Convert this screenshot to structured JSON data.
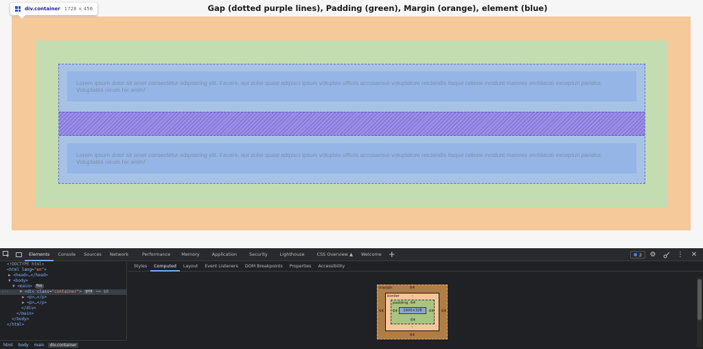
{
  "tooltip": {
    "selector": "div.container",
    "size": "1728 × 456"
  },
  "page_title": "Gap (dotted purple lines), Padding (green), Margin (orange), element (blue)",
  "lorem_text": "Lorem ipsum dolor sit amet consectetur adipisicing elit. Facere, aut dolor quasi adipisci ipsum voluptas officiis accusamus voluptatum reiciendis itaque ratione incidunt maiores architecto excepturi pariatur. Voluptates rerum hic enim!",
  "devtools": {
    "tabs": [
      "Elements",
      "Console",
      "Sources",
      "Network",
      "Performance",
      "Memory",
      "Application",
      "Security",
      "Lighthouse",
      "CSS Overview ▲",
      "Welcome"
    ],
    "add_tab": "+",
    "issues_count": "2",
    "subtabs": [
      "Styles",
      "Computed",
      "Layout",
      "Event Listeners",
      "DOM Breakpoints",
      "Properties",
      "Accessibility"
    ],
    "breadcrumb": [
      "html",
      "body",
      "main",
      "div.container"
    ]
  },
  "dom_tree": {
    "doctype": "<!DOCTYPE html>",
    "html_open_tag": "<html",
    "html_lang_attr": " lang=",
    "html_lang_val": "\"en\"",
    "html_close_bracket": ">",
    "head_line": "<head>…</head>",
    "body_open": "<body>",
    "main_open": "<main>",
    "main_badge": "flex",
    "div_open": "<div",
    "div_class_attr": " class=",
    "div_class_val": "\"container\"",
    "div_close_bracket": ">",
    "div_badge": "grid",
    "div_eq": "== $0",
    "p1": "<p>…</p>",
    "p2": "<p>…</p>",
    "div_close": "</div>",
    "main_close": "</main>",
    "body_close": "</body>",
    "html_close": "</html>"
  },
  "box_model": {
    "margin_label": "margin",
    "margin_top": "64",
    "margin_bottom": "64",
    "margin_left": "64",
    "margin_right": "64",
    "border_label": "border",
    "border_top": "–",
    "border_bottom": "–",
    "padding_label": "padding",
    "padding_top": "64",
    "padding_bottom": "64",
    "padding_left": "64",
    "padding_right": "64",
    "content_size": "1600×328"
  }
}
